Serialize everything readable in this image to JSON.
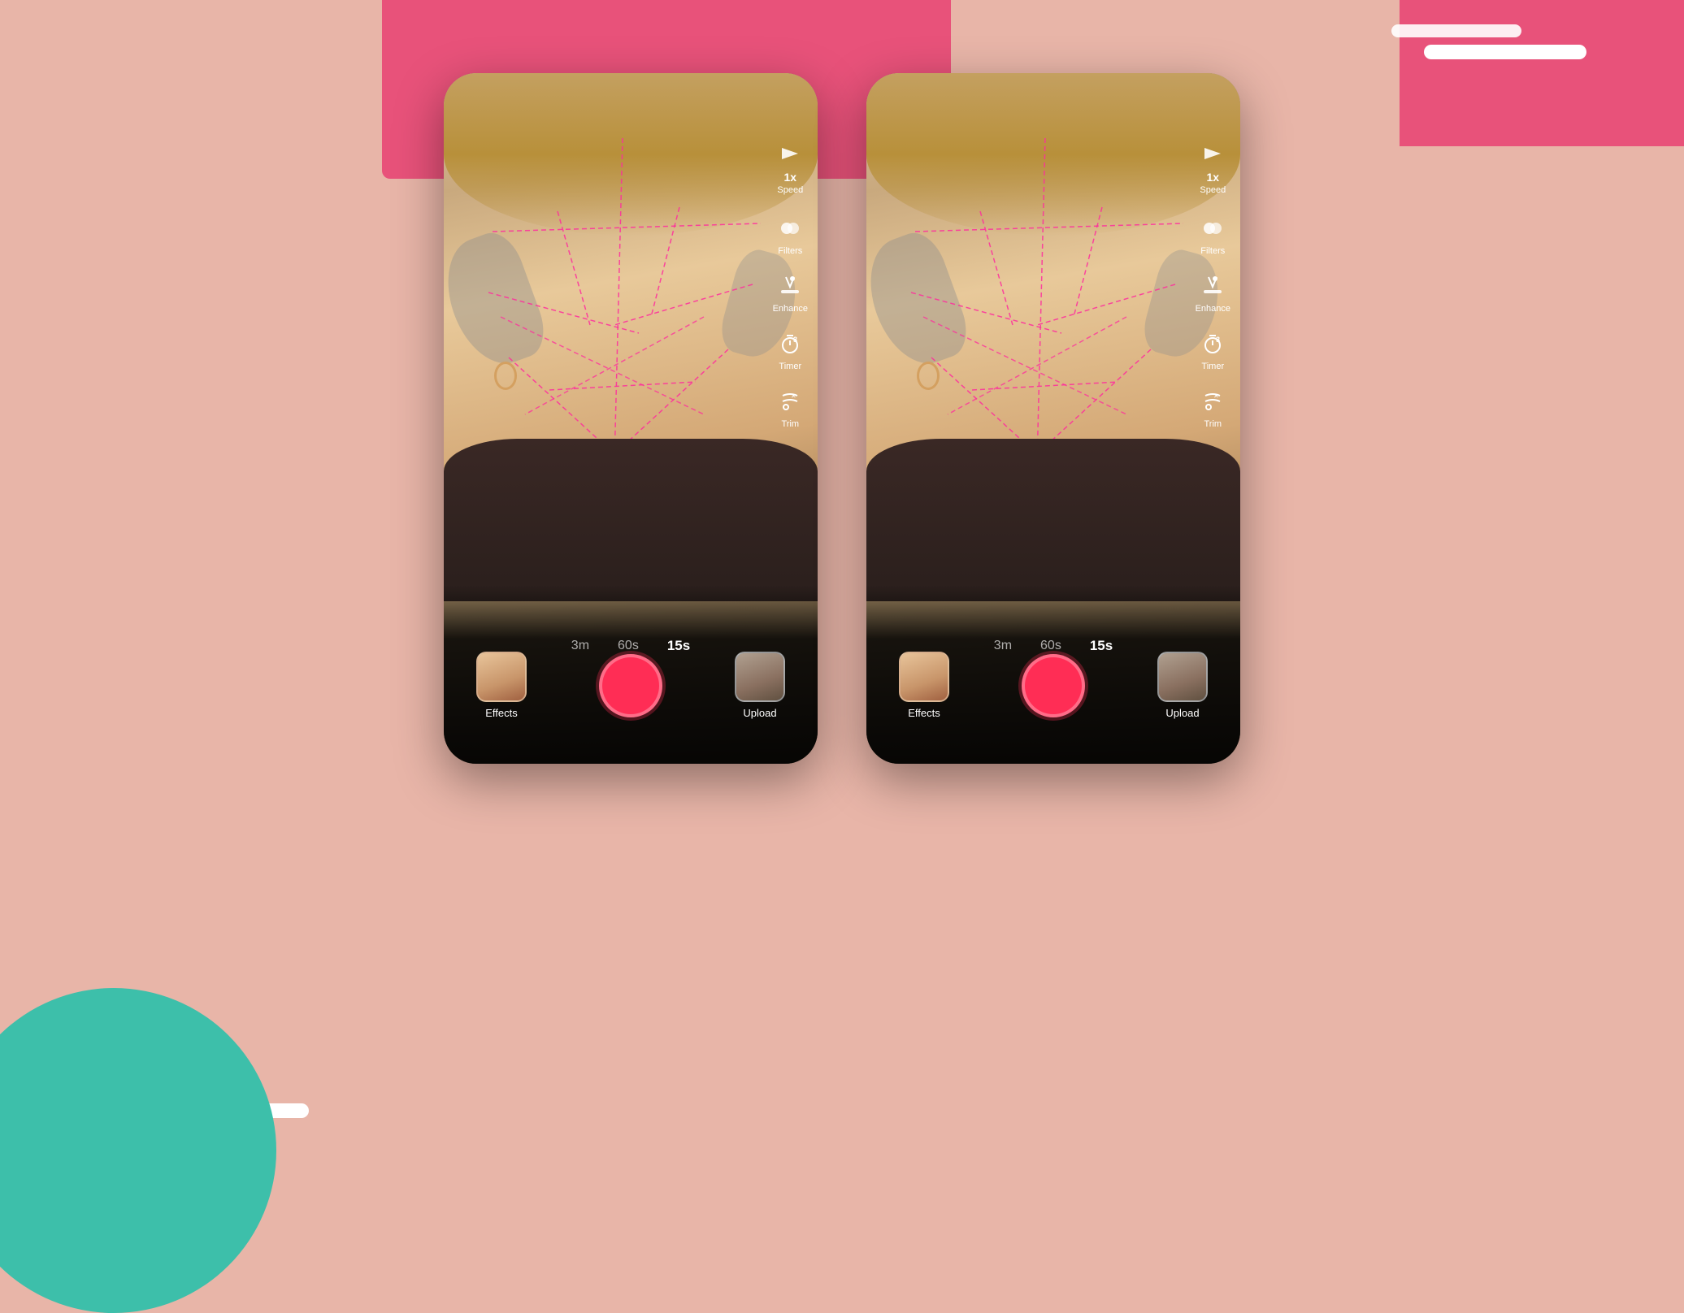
{
  "background": {
    "color": "#e8b5a8",
    "accent_pink": "#e8527a",
    "accent_teal": "#3dbfaa"
  },
  "phones": [
    {
      "id": "phone-left",
      "right_controls": {
        "speed": {
          "value": "1x",
          "label": "Speed"
        },
        "filters": {
          "label": "Filters"
        },
        "enhance": {
          "label": "Enhance"
        },
        "timer": {
          "label": "Timer",
          "badge": "3"
        },
        "trim": {
          "label": "Trim"
        }
      },
      "duration_options": [
        {
          "label": "3m",
          "active": false
        },
        {
          "label": "60s",
          "active": false
        },
        {
          "label": "15s",
          "active": true
        }
      ],
      "effects_button": {
        "label": "Effects"
      },
      "upload_button": {
        "label": "Upload"
      }
    },
    {
      "id": "phone-right",
      "right_controls": {
        "speed": {
          "value": "1x",
          "label": "Speed"
        },
        "filters": {
          "label": "Filters"
        },
        "enhance": {
          "label": "Enhance"
        },
        "timer": {
          "label": "Timer",
          "badge": "3"
        },
        "trim": {
          "label": "Trim"
        }
      },
      "duration_options": [
        {
          "label": "3m",
          "active": false
        },
        {
          "label": "60s",
          "active": false
        },
        {
          "label": "15s",
          "active": true
        }
      ],
      "effects_button": {
        "label": "Effects"
      },
      "upload_button": {
        "label": "Upload"
      }
    }
  ]
}
